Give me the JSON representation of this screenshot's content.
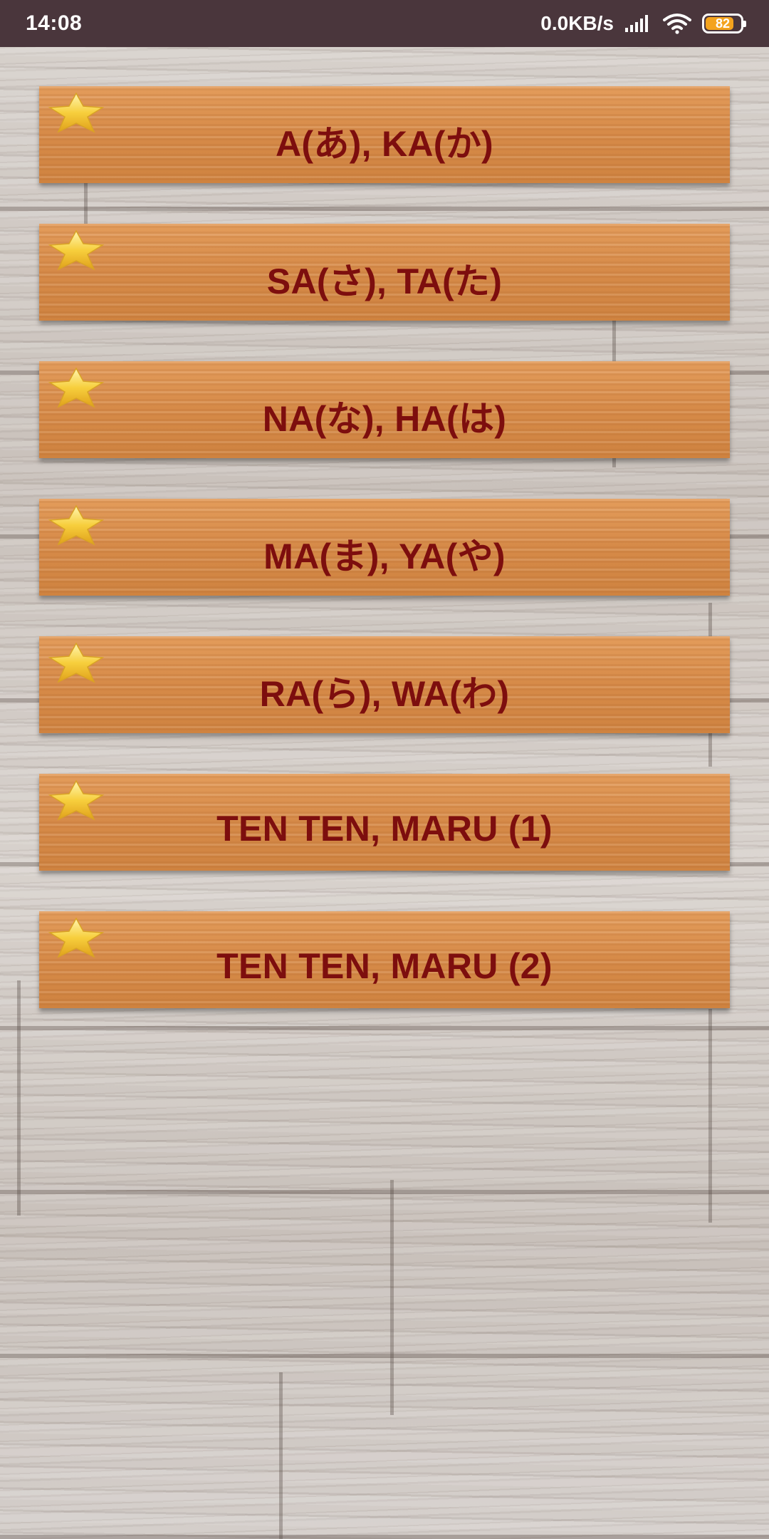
{
  "status_bar": {
    "time": "14:08",
    "net_speed": "0.0KB/s",
    "battery_level": "82",
    "battery_fraction": 0.82,
    "icons": [
      "signal-icon",
      "wifi-icon",
      "battery-icon"
    ]
  },
  "colors": {
    "status_bar_bg": "#4a363c",
    "button_wood": "#d68a48",
    "label_text": "#7d0e0e",
    "battery_fill": "#f4a31d",
    "star": "#f5c73a"
  },
  "menu": {
    "items": [
      {
        "label": "A(あ), KA(か)",
        "icon": "star-icon"
      },
      {
        "label": "SA(さ), TA(た)",
        "icon": "star-icon"
      },
      {
        "label": "NA(な), HA(は)",
        "icon": "star-icon"
      },
      {
        "label": "MA(ま), YA(や)",
        "icon": "star-icon"
      },
      {
        "label": "RA(ら), WA(わ)",
        "icon": "star-icon"
      },
      {
        "label": "TEN TEN, MARU (1)",
        "icon": "star-icon"
      },
      {
        "label": "TEN TEN, MARU (2)",
        "icon": "star-icon"
      }
    ]
  }
}
